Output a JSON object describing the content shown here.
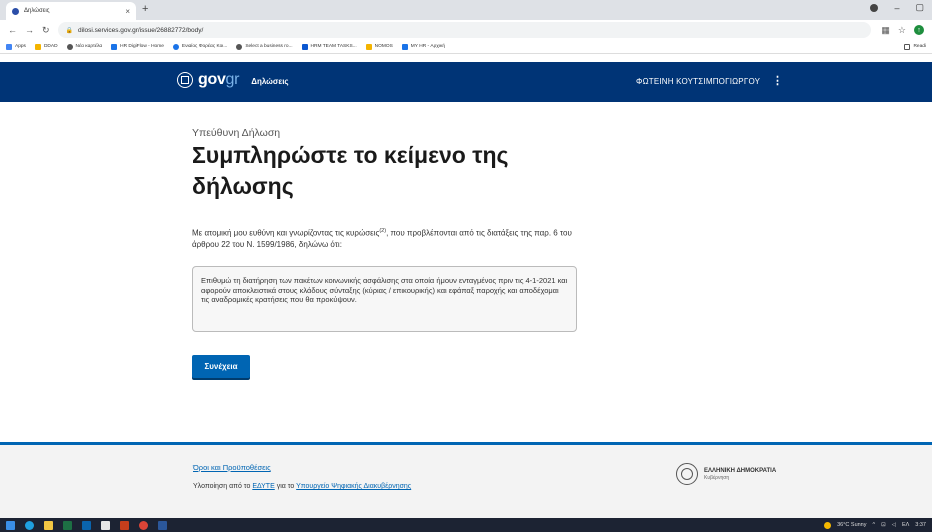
{
  "browser": {
    "tab_title": "Δηλώσεις",
    "tab_close": "×",
    "new_tab": "+",
    "url": "dilosi.services.gov.gr/issue/26882772/body/",
    "win_minimize": "–",
    "win_restore": "▢",
    "bookmarks": [
      {
        "label": "Apps",
        "color": "#4285f4"
      },
      {
        "label": "DDAD",
        "color": "#f4b400"
      },
      {
        "label": "Νέα καρτέλα",
        "color": "#555555"
      },
      {
        "label": "HR DigiFlow - Home",
        "color": "#1a73e8"
      },
      {
        "label": "Ενιαίος Φορέας Κοι...",
        "color": "#1a73e8"
      },
      {
        "label": "Select a business ro...",
        "color": "#555555"
      },
      {
        "label": "HRM TEAM TASKS...",
        "color": "#0b57d0"
      },
      {
        "label": "NOMOS",
        "color": "#f4b400"
      },
      {
        "label": "MY HR - Αρχική",
        "color": "#1a73e8"
      }
    ],
    "reading_list": "Readi"
  },
  "header": {
    "logo_gov": "gov",
    "logo_gr": "gr",
    "service_name": "Δηλώσεις",
    "user_name": "ΦΩΤΕΙΝΗ ΚΟΥΤΣΙΜΠΟΓΙΩΡΓΟΥ",
    "menu_icon": "⋮",
    "bg_color": "#003476"
  },
  "main": {
    "subtitle": "Υπεύθυνη Δήλωση",
    "title": "Συμπληρώστε το κείμενο της δήλωσης",
    "intro_before": "Με ατομική μου ευθύνη και γνωρίζοντας τις κυρώσεις",
    "intro_sup": "(2)",
    "intro_after": ", που προβλέπονται από τις διατάξεις της παρ. 6 του άρθρου 22 του Ν. 1599/1986, δηλώνω ότι:",
    "declaration_text": "Επιθυμώ τη διατήρηση των πακέτων κοινωνικής ασφάλισης στα οποία ήμουν ενταγμένος πριν τις 4-1-2021 και αφορούν αποκλειστικά στους κλάδους σύνταξης (κύριας / επικουρικής) και εφάπαξ παροχής και αποδέχομαι τις αναδρομικές κρατήσεις που θα προκύψουν.",
    "continue_label": "Συνέχεια",
    "accent_color": "#0065b3"
  },
  "footer": {
    "terms_link": "Όροι και Προϋποθέσεις",
    "impl_prefix": "Υλοποίηση από το ",
    "impl_org1": "ΕΔΥΤΕ",
    "impl_mid": " για το ",
    "impl_org2": "Υπουργείο Ψηφιακής Διακυβέρνησης",
    "hellenic_republic": "ΕΛΛΗΝΙΚΗ ΔΗΜΟΚΡΑΤΙΑ",
    "government": "Κυβέρνηση"
  },
  "taskbar": {
    "weather": "36°C Sunny",
    "lang": "ΕΛ",
    "time": "3:37"
  }
}
